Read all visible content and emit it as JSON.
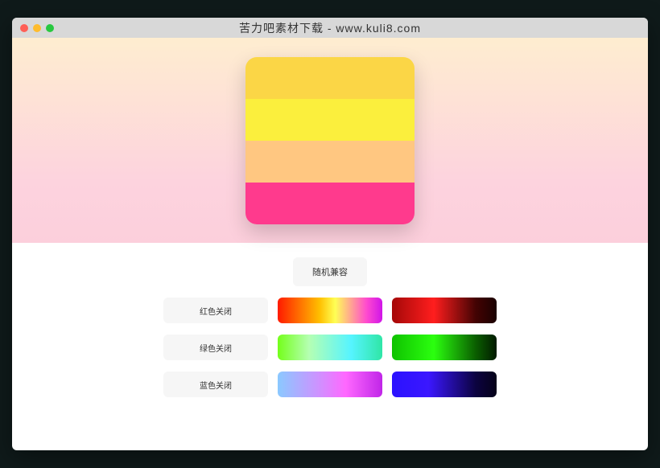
{
  "window": {
    "title": "苦力吧素材下载 - www.kuli8.com"
  },
  "preview": {
    "stripes": [
      "#fbd646",
      "#fbef3d",
      "#ffc781",
      "#ff3a8d"
    ]
  },
  "controls": {
    "random_button": "随机兼容",
    "rows": [
      {
        "label": "红色关闭",
        "light_gradient": "linear-gradient(90deg, #ff1a00 0%, #ffbf00 40%, #ffff55 55%, #ff4acf 85%, #d015e8 100%)",
        "dark_gradient": "linear-gradient(90deg, #a50808 0%, #ff1e1e 40%, #430303 80%, #1a0101 100%)"
      },
      {
        "label": "绿色关闭",
        "light_gradient": "linear-gradient(90deg, #74ff1a 0%, #b5ffb3 30%, #56f4ff 70%, #2fe6a6 100%)",
        "dark_gradient": "linear-gradient(90deg, #0fc200 0%, #2bff0f 40%, #0a5e00 80%, #021a00 100%)"
      },
      {
        "label": "蓝色关闭",
        "light_gradient": "linear-gradient(90deg, #8ac9ff 0%, #d090ff 40%, #ff68ff 65%, #c026e8 100%)",
        "dark_gradient": "linear-gradient(90deg, #2b12ff 0%, #3b17ff 35%, #0c0340 80%, #050118 100%)"
      }
    ]
  }
}
